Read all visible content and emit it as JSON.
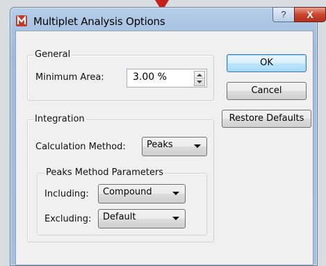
{
  "window": {
    "title": "Multiplet Analysis Options",
    "help_label": "?",
    "close_label": "X"
  },
  "general": {
    "title": "General",
    "min_area_label": "Minimum Area:",
    "min_area_value": "3.00 %"
  },
  "integration": {
    "title": "Integration",
    "calc_method_label": "Calculation Method:",
    "calc_method_value": "Peaks",
    "peaks_group": {
      "title": "Peaks Method Parameters",
      "including_label": "Including:",
      "including_value": "Compound",
      "excluding_label": "Excluding:",
      "excluding_value": "Default"
    }
  },
  "buttons": {
    "ok": "OK",
    "cancel": "Cancel",
    "restore": "Restore Defaults"
  },
  "colors": {
    "accent": "#c6201c",
    "title_bar": "#a9c4e2",
    "dialog_bg": "#f0f0f0"
  }
}
